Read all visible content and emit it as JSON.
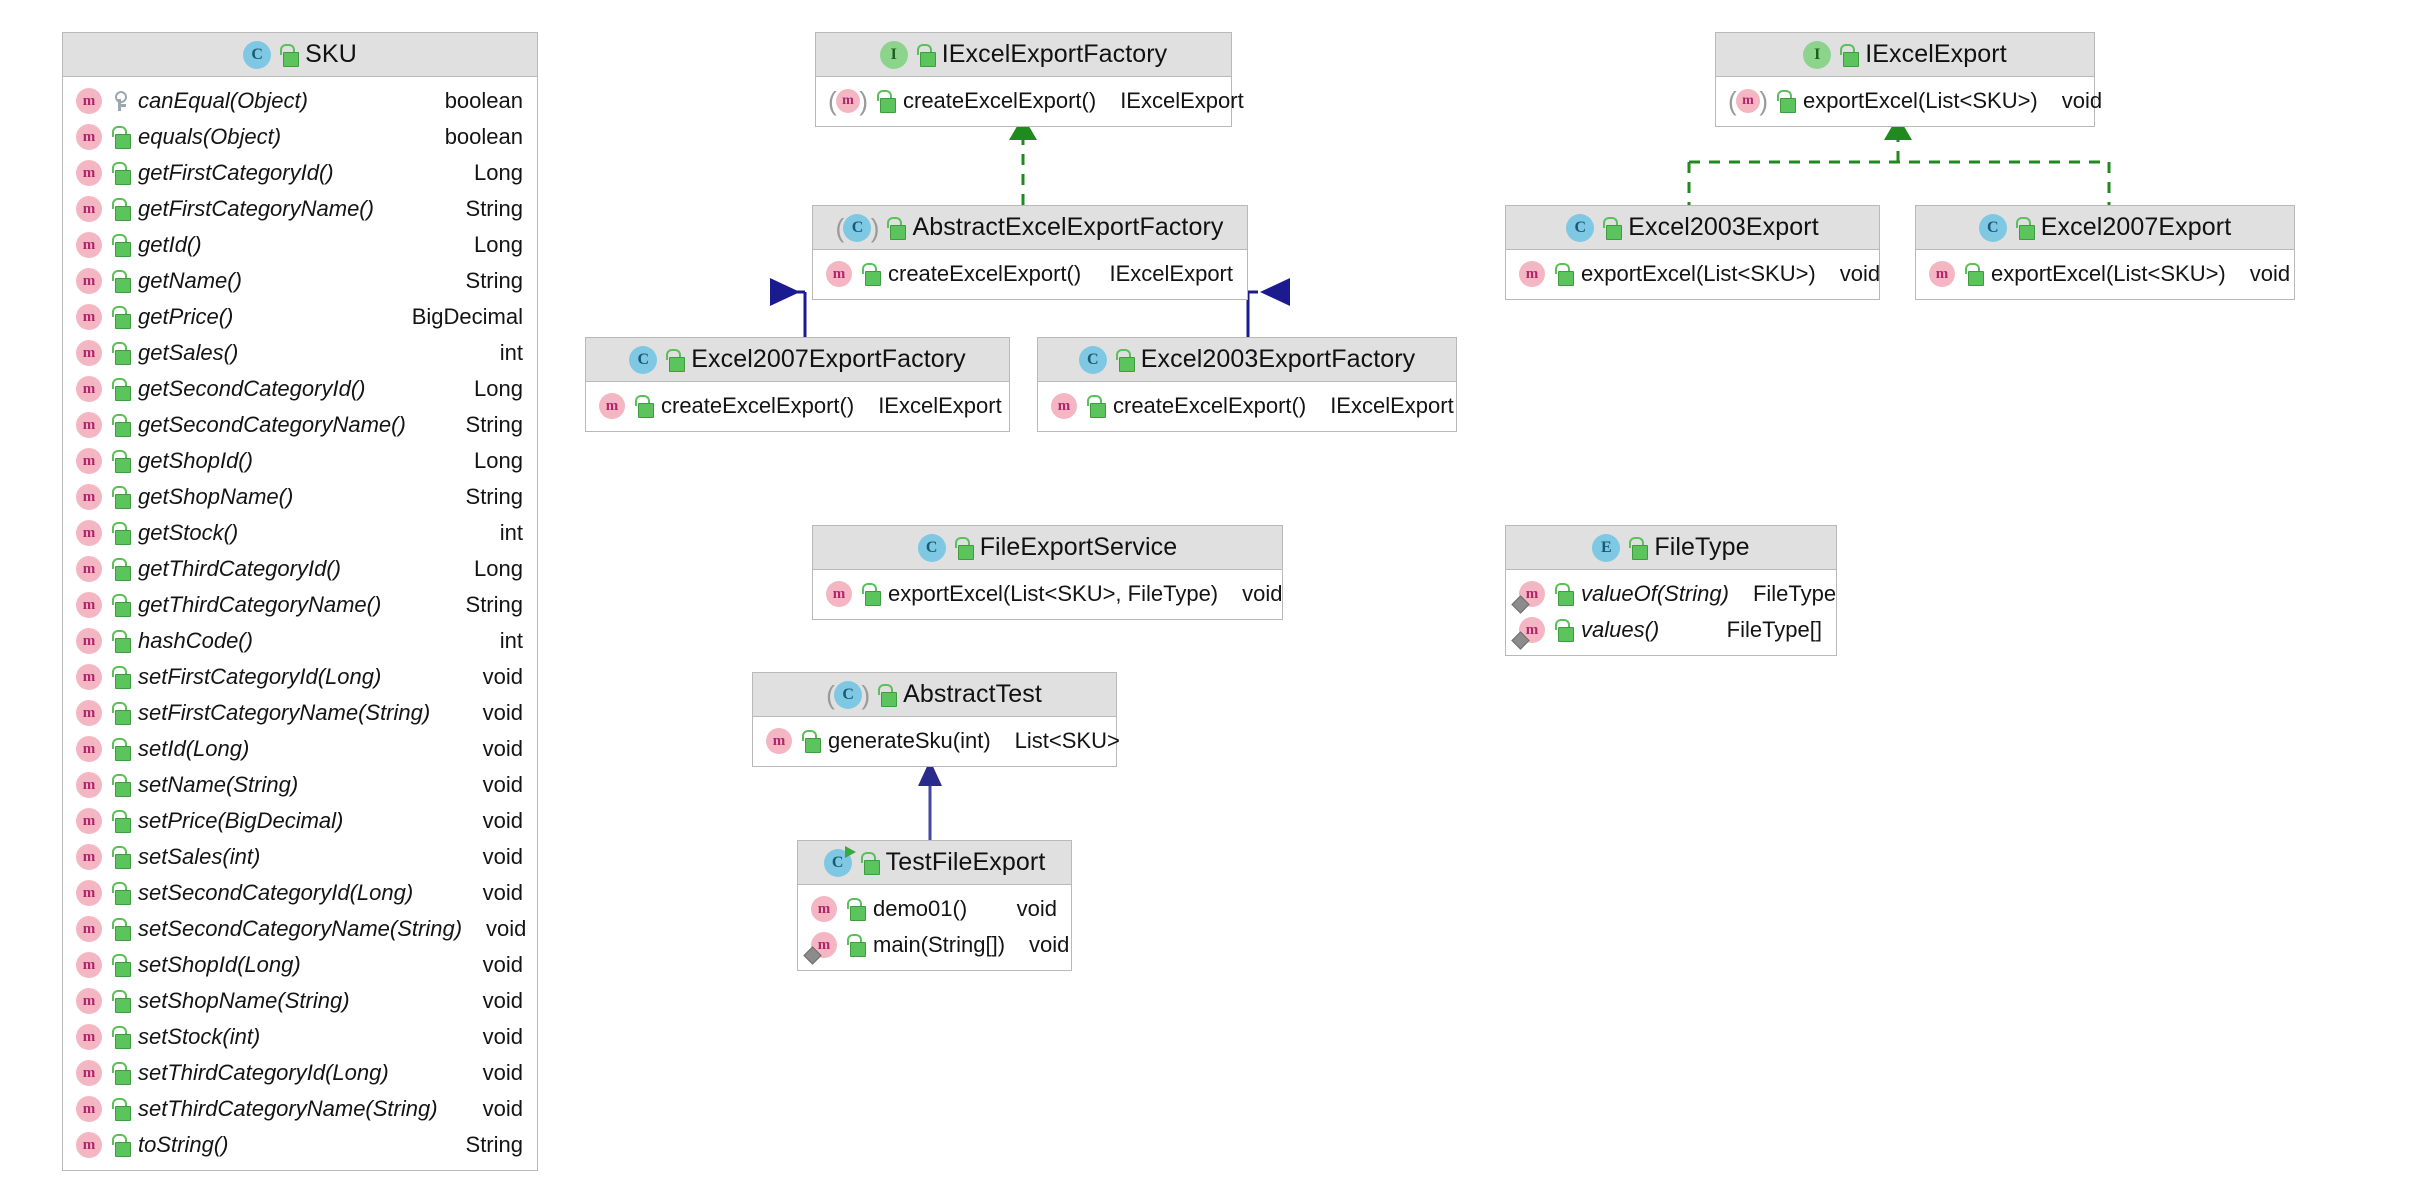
{
  "diagram": {
    "title": "Excel Export Factory UML Class Diagram",
    "colors": {
      "class_icon": "#7ec8e3",
      "interface_icon": "#8cd48c",
      "enum_icon": "#7ec8e3",
      "method_icon": "#f4b6c2",
      "lock_icon": "#5cc45c",
      "inheritance_line": "#1b1b8f",
      "realization_line": "#1f8b1f",
      "header_bg": "#e0e0e0",
      "node_border": "#b9b9b9"
    },
    "legend": {
      "class_glyph": "C",
      "interface_glyph": "I",
      "enum_glyph": "E",
      "method_glyph": "m"
    }
  },
  "nodes": {
    "sku": {
      "name": "SKU",
      "stereotype": "class",
      "icon": "class-icon",
      "visibility_icon": "unlocked-icon",
      "members": [
        {
          "name": "canEqual(Object)",
          "type": "boolean",
          "icon": "method-icon",
          "access_icon": "key-icon",
          "italic": true,
          "static": false
        },
        {
          "name": "equals(Object)",
          "type": "boolean",
          "icon": "method-icon",
          "access_icon": "unlocked-icon",
          "italic": true,
          "static": false
        },
        {
          "name": "getFirstCategoryId()",
          "type": "Long",
          "icon": "method-icon",
          "access_icon": "unlocked-icon",
          "italic": true,
          "static": false
        },
        {
          "name": "getFirstCategoryName()",
          "type": "String",
          "icon": "method-icon",
          "access_icon": "unlocked-icon",
          "italic": true,
          "static": false
        },
        {
          "name": "getId()",
          "type": "Long",
          "icon": "method-icon",
          "access_icon": "unlocked-icon",
          "italic": true,
          "static": false
        },
        {
          "name": "getName()",
          "type": "String",
          "icon": "method-icon",
          "access_icon": "unlocked-icon",
          "italic": true,
          "static": false
        },
        {
          "name": "getPrice()",
          "type": "BigDecimal",
          "icon": "method-icon",
          "access_icon": "unlocked-icon",
          "italic": true,
          "static": false
        },
        {
          "name": "getSales()",
          "type": "int",
          "icon": "method-icon",
          "access_icon": "unlocked-icon",
          "italic": true,
          "static": false
        },
        {
          "name": "getSecondCategoryId()",
          "type": "Long",
          "icon": "method-icon",
          "access_icon": "unlocked-icon",
          "italic": true,
          "static": false
        },
        {
          "name": "getSecondCategoryName()",
          "type": "String",
          "icon": "method-icon",
          "access_icon": "unlocked-icon",
          "italic": true,
          "static": false
        },
        {
          "name": "getShopId()",
          "type": "Long",
          "icon": "method-icon",
          "access_icon": "unlocked-icon",
          "italic": true,
          "static": false
        },
        {
          "name": "getShopName()",
          "type": "String",
          "icon": "method-icon",
          "access_icon": "unlocked-icon",
          "italic": true,
          "static": false
        },
        {
          "name": "getStock()",
          "type": "int",
          "icon": "method-icon",
          "access_icon": "unlocked-icon",
          "italic": true,
          "static": false
        },
        {
          "name": "getThirdCategoryId()",
          "type": "Long",
          "icon": "method-icon",
          "access_icon": "unlocked-icon",
          "italic": true,
          "static": false
        },
        {
          "name": "getThirdCategoryName()",
          "type": "String",
          "icon": "method-icon",
          "access_icon": "unlocked-icon",
          "italic": true,
          "static": false
        },
        {
          "name": "hashCode()",
          "type": "int",
          "icon": "method-icon",
          "access_icon": "unlocked-icon",
          "italic": true,
          "static": false
        },
        {
          "name": "setFirstCategoryId(Long)",
          "type": "void",
          "icon": "method-icon",
          "access_icon": "unlocked-icon",
          "italic": true,
          "static": false
        },
        {
          "name": "setFirstCategoryName(String)",
          "type": "void",
          "icon": "method-icon",
          "access_icon": "unlocked-icon",
          "italic": true,
          "static": false
        },
        {
          "name": "setId(Long)",
          "type": "void",
          "icon": "method-icon",
          "access_icon": "unlocked-icon",
          "italic": true,
          "static": false
        },
        {
          "name": "setName(String)",
          "type": "void",
          "icon": "method-icon",
          "access_icon": "unlocked-icon",
          "italic": true,
          "static": false
        },
        {
          "name": "setPrice(BigDecimal)",
          "type": "void",
          "icon": "method-icon",
          "access_icon": "unlocked-icon",
          "italic": true,
          "static": false
        },
        {
          "name": "setSales(int)",
          "type": "void",
          "icon": "method-icon",
          "access_icon": "unlocked-icon",
          "italic": true,
          "static": false
        },
        {
          "name": "setSecondCategoryId(Long)",
          "type": "void",
          "icon": "method-icon",
          "access_icon": "unlocked-icon",
          "italic": true,
          "static": false
        },
        {
          "name": "setSecondCategoryName(String)",
          "type": "void",
          "icon": "method-icon",
          "access_icon": "unlocked-icon",
          "italic": true,
          "static": false
        },
        {
          "name": "setShopId(Long)",
          "type": "void",
          "icon": "method-icon",
          "access_icon": "unlocked-icon",
          "italic": true,
          "static": false
        },
        {
          "name": "setShopName(String)",
          "type": "void",
          "icon": "method-icon",
          "access_icon": "unlocked-icon",
          "italic": true,
          "static": false
        },
        {
          "name": "setStock(int)",
          "type": "void",
          "icon": "method-icon",
          "access_icon": "unlocked-icon",
          "italic": true,
          "static": false
        },
        {
          "name": "setThirdCategoryId(Long)",
          "type": "void",
          "icon": "method-icon",
          "access_icon": "unlocked-icon",
          "italic": true,
          "static": false
        },
        {
          "name": "setThirdCategoryName(String)",
          "type": "void",
          "icon": "method-icon",
          "access_icon": "unlocked-icon",
          "italic": true,
          "static": false
        },
        {
          "name": "toString()",
          "type": "String",
          "icon": "method-icon",
          "access_icon": "unlocked-icon",
          "italic": true,
          "static": false
        }
      ]
    },
    "iexcelexportfactory": {
      "name": "IExcelExportFactory",
      "stereotype": "interface",
      "icon": "interface-icon",
      "visibility_icon": "unlocked-icon",
      "members": [
        {
          "name": "createExcelExport()",
          "type": "IExcelExport",
          "icon": "method-icon",
          "access_icon": "unlocked-icon",
          "italic": false,
          "abstract": true,
          "static": false
        }
      ]
    },
    "abstractexcelexportfactory": {
      "name": "AbstractExcelExportFactory",
      "stereotype": "abstract-class",
      "icon": "class-icon",
      "visibility_icon": "unlocked-icon",
      "members": [
        {
          "name": "createExcelExport()",
          "type": "IExcelExport",
          "icon": "method-icon",
          "access_icon": "unlocked-icon",
          "italic": false,
          "static": false
        }
      ]
    },
    "excel2007exportfactory": {
      "name": "Excel2007ExportFactory",
      "stereotype": "class",
      "icon": "class-icon",
      "visibility_icon": "unlocked-icon",
      "members": [
        {
          "name": "createExcelExport()",
          "type": "IExcelExport",
          "icon": "method-icon",
          "access_icon": "unlocked-icon",
          "italic": false,
          "static": false
        }
      ]
    },
    "excel2003exportfactory": {
      "name": "Excel2003ExportFactory",
      "stereotype": "class",
      "icon": "class-icon",
      "visibility_icon": "unlocked-icon",
      "members": [
        {
          "name": "createExcelExport()",
          "type": "IExcelExport",
          "icon": "method-icon",
          "access_icon": "unlocked-icon",
          "italic": false,
          "static": false
        }
      ]
    },
    "iexcelexport": {
      "name": "IExcelExport",
      "stereotype": "interface",
      "icon": "interface-icon",
      "visibility_icon": "unlocked-icon",
      "members": [
        {
          "name": "exportExcel(List<SKU>)",
          "type": "void",
          "icon": "method-icon",
          "access_icon": "unlocked-icon",
          "italic": false,
          "abstract": true,
          "static": false
        }
      ]
    },
    "excel2003export": {
      "name": "Excel2003Export",
      "stereotype": "class",
      "icon": "class-icon",
      "visibility_icon": "unlocked-icon",
      "members": [
        {
          "name": "exportExcel(List<SKU>)",
          "type": "void",
          "icon": "method-icon",
          "access_icon": "unlocked-icon",
          "italic": false,
          "static": false
        }
      ]
    },
    "excel2007export": {
      "name": "Excel2007Export",
      "stereotype": "class",
      "icon": "class-icon",
      "visibility_icon": "unlocked-icon",
      "members": [
        {
          "name": "exportExcel(List<SKU>)",
          "type": "void",
          "icon": "method-icon",
          "access_icon": "unlocked-icon",
          "italic": false,
          "static": false
        }
      ]
    },
    "fileexportservice": {
      "name": "FileExportService",
      "stereotype": "class",
      "icon": "class-icon",
      "visibility_icon": "unlocked-icon",
      "members": [
        {
          "name": "exportExcel(List<SKU>, FileType)",
          "type": "void",
          "icon": "method-icon",
          "access_icon": "unlocked-icon",
          "italic": false,
          "static": false
        }
      ]
    },
    "filetype": {
      "name": "FileType",
      "stereotype": "enum",
      "icon": "enum-icon",
      "visibility_icon": "unlocked-icon",
      "members": [
        {
          "name": "valueOf(String)",
          "type": "FileType",
          "icon": "method-icon",
          "access_icon": "unlocked-icon",
          "italic": true,
          "static": true
        },
        {
          "name": "values()",
          "type": "FileType[]",
          "icon": "method-icon",
          "access_icon": "unlocked-icon",
          "italic": true,
          "static": true
        }
      ]
    },
    "abstracttest": {
      "name": "AbstractTest",
      "stereotype": "abstract-class",
      "icon": "class-icon",
      "visibility_icon": "unlocked-icon",
      "members": [
        {
          "name": "generateSku(int)",
          "type": "List<SKU>",
          "icon": "method-icon",
          "access_icon": "unlocked-icon",
          "italic": false,
          "static": false
        }
      ]
    },
    "testfileexport": {
      "name": "TestFileExport",
      "stereotype": "runnable-class",
      "icon": "class-icon",
      "visibility_icon": "unlocked-icon",
      "members": [
        {
          "name": "demo01()",
          "type": "void",
          "icon": "method-icon",
          "access_icon": "unlocked-icon",
          "italic": false,
          "static": false
        },
        {
          "name": "main(String[])",
          "type": "void",
          "icon": "method-icon",
          "access_icon": "unlocked-icon",
          "italic": false,
          "static": true
        }
      ]
    }
  },
  "relations": [
    {
      "from": "AbstractExcelExportFactory",
      "to": "IExcelExportFactory",
      "kind": "realization"
    },
    {
      "from": "Excel2007ExportFactory",
      "to": "AbstractExcelExportFactory",
      "kind": "generalization"
    },
    {
      "from": "Excel2003ExportFactory",
      "to": "AbstractExcelExportFactory",
      "kind": "generalization"
    },
    {
      "from": "Excel2003Export",
      "to": "IExcelExport",
      "kind": "realization"
    },
    {
      "from": "Excel2007Export",
      "to": "IExcelExport",
      "kind": "realization"
    },
    {
      "from": "TestFileExport",
      "to": "AbstractTest",
      "kind": "generalization"
    }
  ]
}
